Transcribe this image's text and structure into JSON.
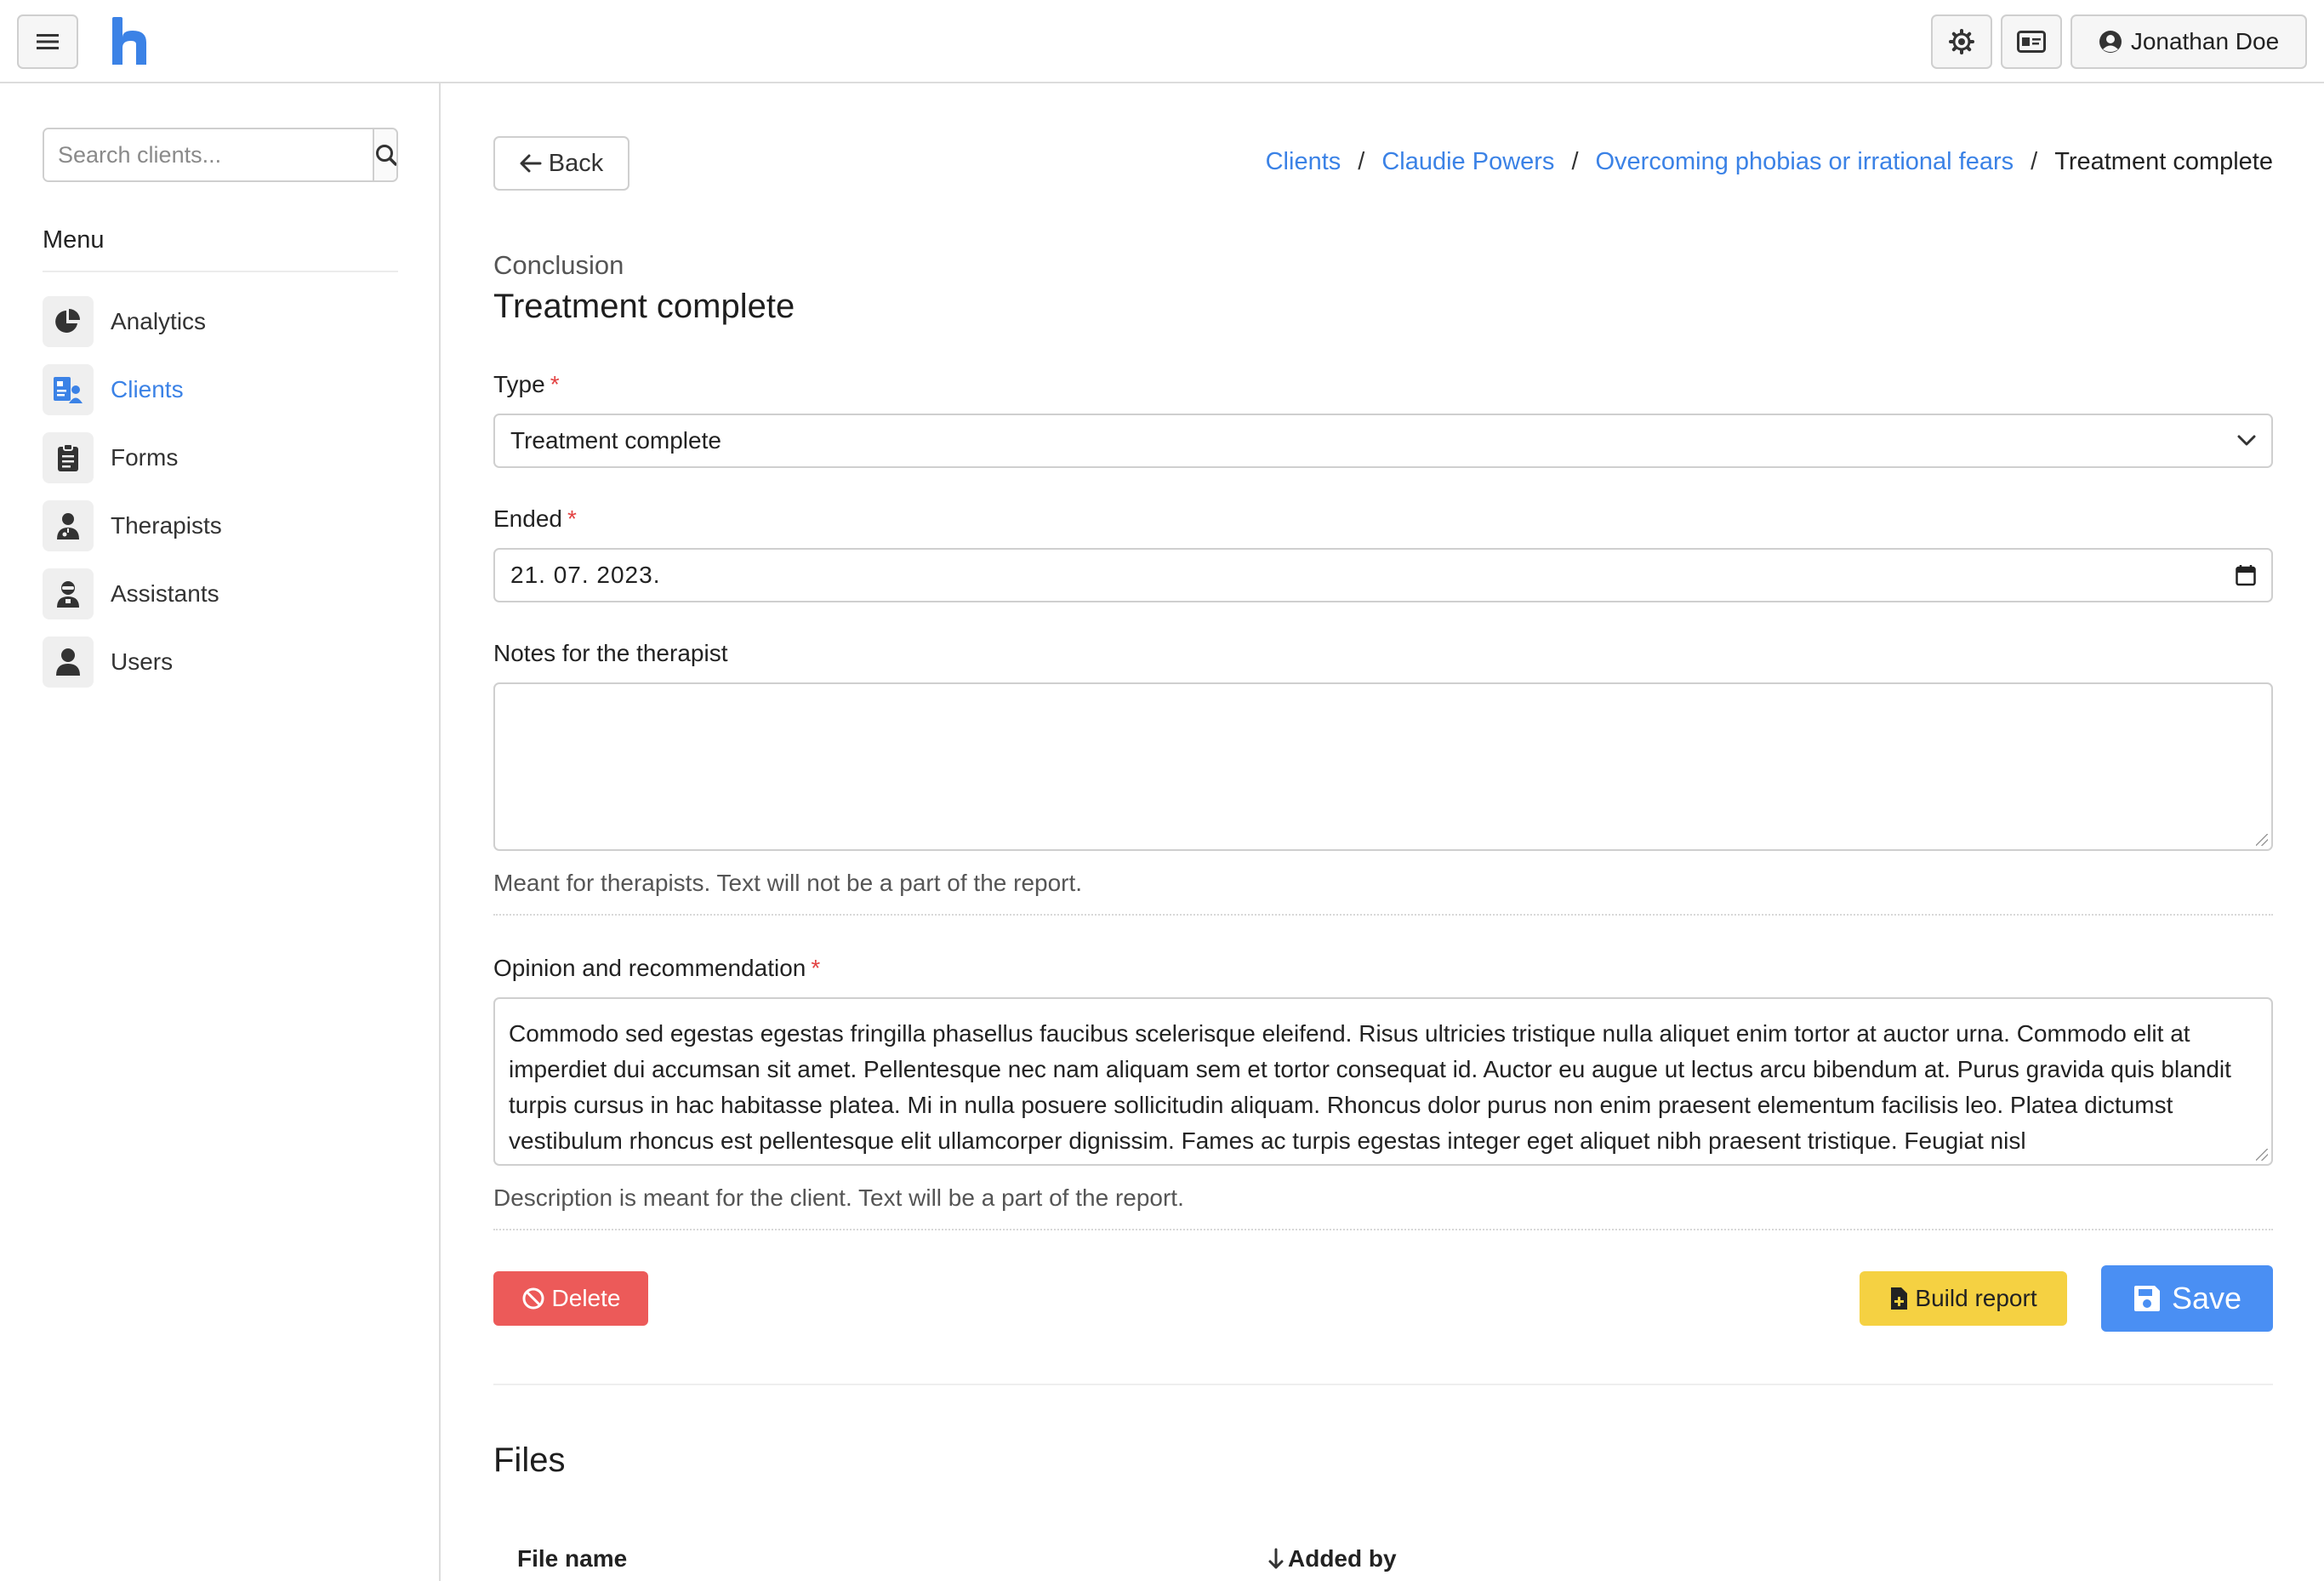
{
  "header": {
    "menu_icon": "hamburger-icon",
    "logo_letter": "h",
    "theme_icon": "gear-icon",
    "id_card_icon": "id-card-icon",
    "user_name": "Jonathan Doe",
    "user_icon": "user-circle-icon"
  },
  "sidebar": {
    "search_placeholder": "Search clients...",
    "search_icon": "search-icon",
    "menu_title": "Menu",
    "items": [
      {
        "label": "Analytics",
        "icon": "chart-pie-icon",
        "active": false
      },
      {
        "label": "Clients",
        "icon": "clients-card-icon",
        "active": true
      },
      {
        "label": "Forms",
        "icon": "clipboard-icon",
        "active": false
      },
      {
        "label": "Therapists",
        "icon": "therapist-icon",
        "active": false
      },
      {
        "label": "Assistants",
        "icon": "assistant-icon",
        "active": false
      },
      {
        "label": "Users",
        "icon": "user-icon",
        "active": false
      }
    ]
  },
  "main": {
    "back_label": "Back",
    "breadcrumb": {
      "items": [
        "Clients",
        "Claudie Powers",
        "Overcoming phobias or irrational fears"
      ],
      "current": "Treatment complete",
      "separator": "/"
    },
    "subtitle": "Conclusion",
    "title": "Treatment complete",
    "form": {
      "type_label": "Type",
      "type_value": "Treatment complete",
      "ended_label": "Ended",
      "ended_value": "21. 07. 2023.",
      "notes_label": "Notes for the therapist",
      "notes_value": "",
      "notes_help": "Meant for therapists. Text will not be a part of the report.",
      "opinion_label": "Opinion and recommendation",
      "opinion_value": "Commodo sed egestas egestas fringilla phasellus faucibus scelerisque eleifend. Risus ultricies tristique nulla aliquet enim tortor at auctor urna. Commodo elit at imperdiet dui accumsan sit amet. Pellentesque nec nam aliquam sem et tortor consequat id. Auctor eu augue ut lectus arcu bibendum at. Purus gravida quis blandit turpis cursus in hac habitasse platea. Mi in nulla posuere sollicitudin aliquam. Rhoncus dolor purus non enim praesent elementum facilisis leo. Platea dictumst vestibulum rhoncus est pellentesque elit ullamcorper dignissim. Fames ac turpis egestas integer eget aliquet nibh praesent tristique. Feugiat nisl",
      "opinion_help": "Description is meant for the client. Text will be a part of the report.",
      "required_mark": "*"
    },
    "actions": {
      "delete_label": "Delete",
      "report_label": "Build report",
      "save_label": "Save"
    },
    "files": {
      "title": "Files",
      "columns": [
        "File name",
        "Added by"
      ]
    }
  },
  "colors": {
    "accent": "#3b82e6",
    "danger": "#ec5a59",
    "warning": "#f5d142",
    "primary_button": "#4a8ff3"
  }
}
